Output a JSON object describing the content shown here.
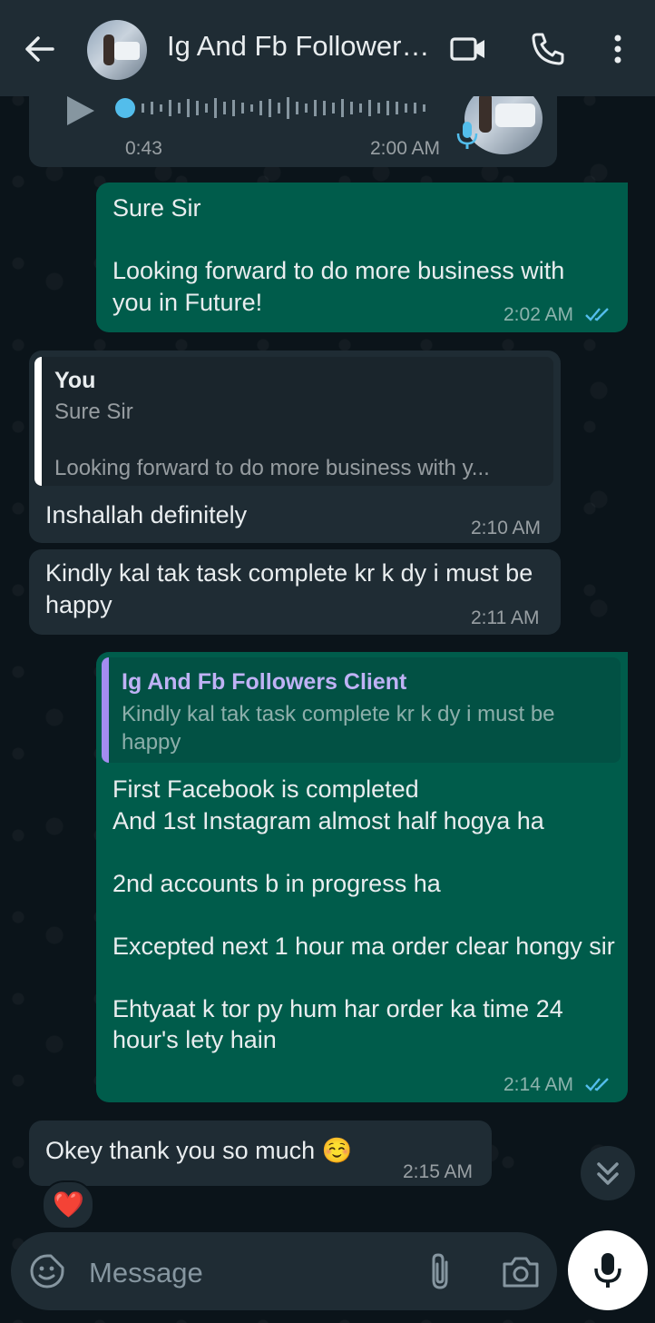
{
  "header": {
    "title": "Ig And Fb Followers Client",
    "back_icon": "arrow-left-icon",
    "video_icon": "video-camera-icon",
    "call_icon": "phone-icon",
    "menu_icon": "more-vertical-icon"
  },
  "messages": [
    {
      "type": "voice",
      "direction": "incoming",
      "duration": "0:43",
      "time": "2:00 AM",
      "progress": 0.0
    },
    {
      "type": "text",
      "direction": "outgoing",
      "text": "Sure Sir\n\nLooking forward to do more business with you in Future!",
      "time": "2:02 AM",
      "status": "read"
    },
    {
      "type": "text",
      "direction": "incoming",
      "quote": {
        "author": "You",
        "text": "Sure Sir\n\nLooking forward to do more business with y..."
      },
      "text": "Inshallah definitely",
      "time": "2:10 AM"
    },
    {
      "type": "text",
      "direction": "incoming",
      "text": "Kindly kal tak task complete kr k dy i must be happy",
      "time": "2:11 AM"
    },
    {
      "type": "text",
      "direction": "outgoing",
      "quote": {
        "author": "Ig And Fb Followers Client",
        "text": "Kindly kal tak task complete kr k dy i must be happy"
      },
      "text": "First Facebook is completed\nAnd 1st Instagram almost half hogya ha\n\n2nd accounts b in progress ha\n\nExcepted next 1 hour ma order clear hongy sir\n\nEhtyaat k tor py hum har order ka time 24 hour's lety hain",
      "time": "2:14 AM",
      "status": "read"
    },
    {
      "type": "text",
      "direction": "incoming",
      "text": "Okey thank you so much ☺️",
      "time": "2:15 AM",
      "reaction": "❤️"
    }
  ],
  "composer": {
    "placeholder": "Message",
    "emoji_icon": "sticker-emoji-icon",
    "attach_icon": "paperclip-icon",
    "camera_icon": "camera-icon",
    "mic_icon": "microphone-icon"
  },
  "colors": {
    "background": "#0b141a",
    "header": "#1f2c34",
    "incoming_bubble": "#1f2c34",
    "outgoing_bubble": "#005c4b",
    "read_tick": "#53bdeb",
    "quote_bar_self": "#ffffff",
    "quote_bar_contact": "#a38cf0"
  }
}
